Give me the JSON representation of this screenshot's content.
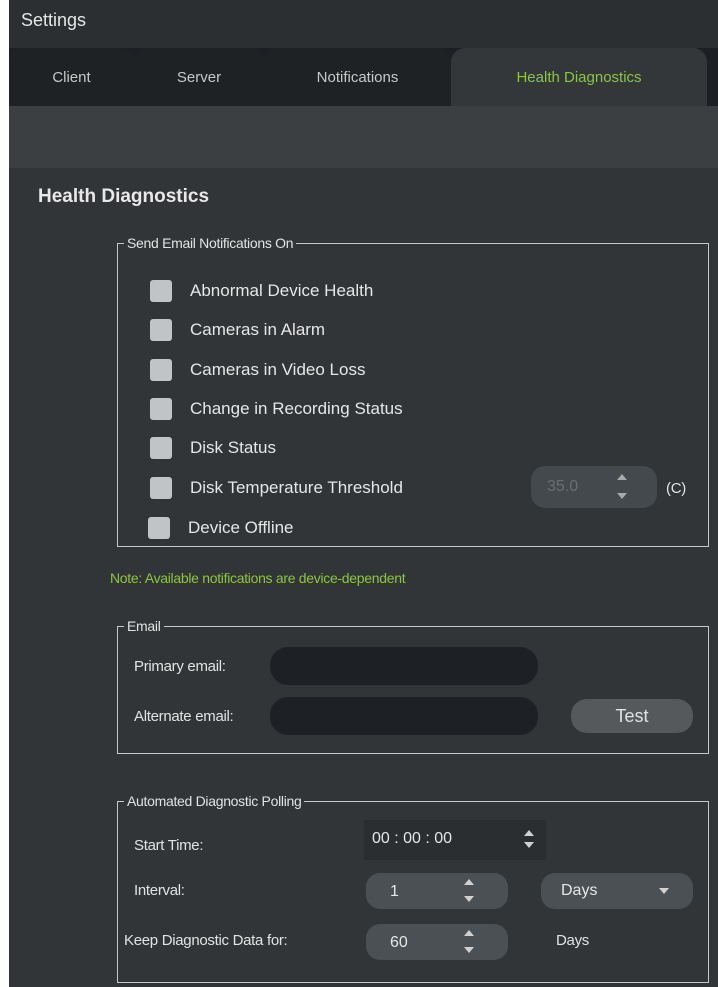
{
  "window": {
    "title": "Settings"
  },
  "tabs": [
    {
      "label": "Client"
    },
    {
      "label": "Server"
    },
    {
      "label": "Notifications"
    },
    {
      "label": "Health Diagnostics",
      "active": true
    }
  ],
  "section_title": "Health Diagnostics",
  "email_notifications": {
    "legend": "Send Email Notifications On",
    "options": [
      {
        "label": "Abnormal Device Health",
        "checked": false
      },
      {
        "label": "Cameras in Alarm",
        "checked": false
      },
      {
        "label": "Cameras in Video Loss",
        "checked": false
      },
      {
        "label": "Change in Recording Status",
        "checked": false
      },
      {
        "label": "Disk Status",
        "checked": false
      },
      {
        "label": "Disk Temperature Threshold",
        "checked": false
      },
      {
        "label": "Device Offline",
        "checked": false
      }
    ],
    "threshold_value": "35.0",
    "threshold_unit": "(C)"
  },
  "note": "Note: Available notifications are device-dependent",
  "email": {
    "legend": "Email",
    "primary_label": "Primary email:",
    "primary_value": "",
    "alternate_label": "Alternate email:",
    "alternate_value": "",
    "test_label": "Test"
  },
  "polling": {
    "legend": "Automated Diagnostic Polling",
    "start_time_label": "Start Time:",
    "start_time_value": "00 : 00 : 00",
    "interval_label": "Interval:",
    "interval_value": "1",
    "interval_unit": "Days",
    "keep_label": "Keep Diagnostic Data for:",
    "keep_value": "60",
    "keep_unit": "Days"
  },
  "colors": {
    "accent": "#8cc63f",
    "background": "#313538",
    "tabbar": "#1c2024"
  },
  "icons": [
    "spin-up-icon",
    "spin-down-icon",
    "dropdown-arrow-icon",
    "checkbox-icon"
  ]
}
